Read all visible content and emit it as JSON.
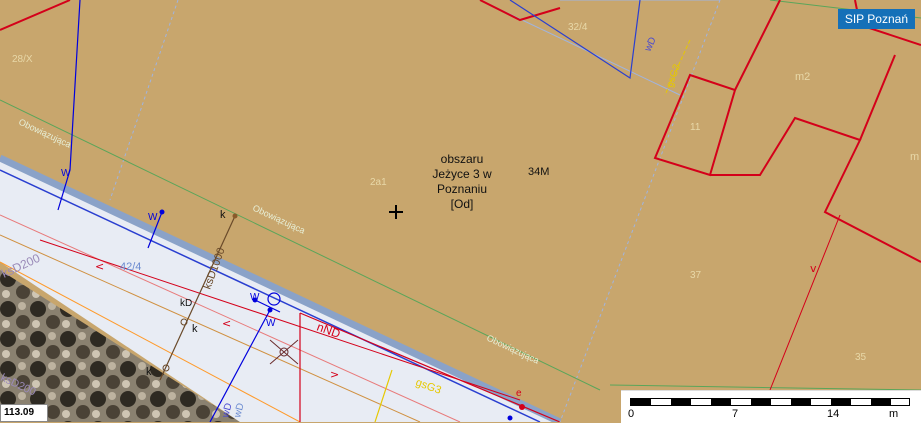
{
  "badge": "SIP Poznań",
  "area_label": [
    "obszaru",
    "Jeżyce 3 w",
    "Poznaniu",
    "[Od]"
  ],
  "coordinate": "113.09",
  "scale": {
    "ticks": [
      "0",
      "7",
      "14"
    ],
    "unit": "m"
  },
  "parcel_labels": [
    "34M",
    "2a1",
    "28/X",
    "32/4",
    "m2",
    "11",
    "37",
    "35",
    "m"
  ],
  "zone_labels": [
    "Obowiązująca",
    "Obowiązująca",
    "Obowiązująca"
  ],
  "utility_labels": [
    "ksD200",
    "ksD200",
    "42/4",
    "kD",
    "k",
    "k",
    "k",
    "W",
    "W",
    "W",
    "W",
    "wD",
    "wD",
    "wD",
    "nND",
    "gsG3",
    "gsG3",
    "e",
    "ksD1000"
  ],
  "colors": {
    "parcel_fill": "#c8a66d",
    "road": "#e8ecf4",
    "boundary_red": "#d4001a",
    "water_blue": "#0000dd",
    "zone_green": "#5aa55a",
    "gas_yellow": "#e6c800",
    "badge": "#1570b8"
  }
}
